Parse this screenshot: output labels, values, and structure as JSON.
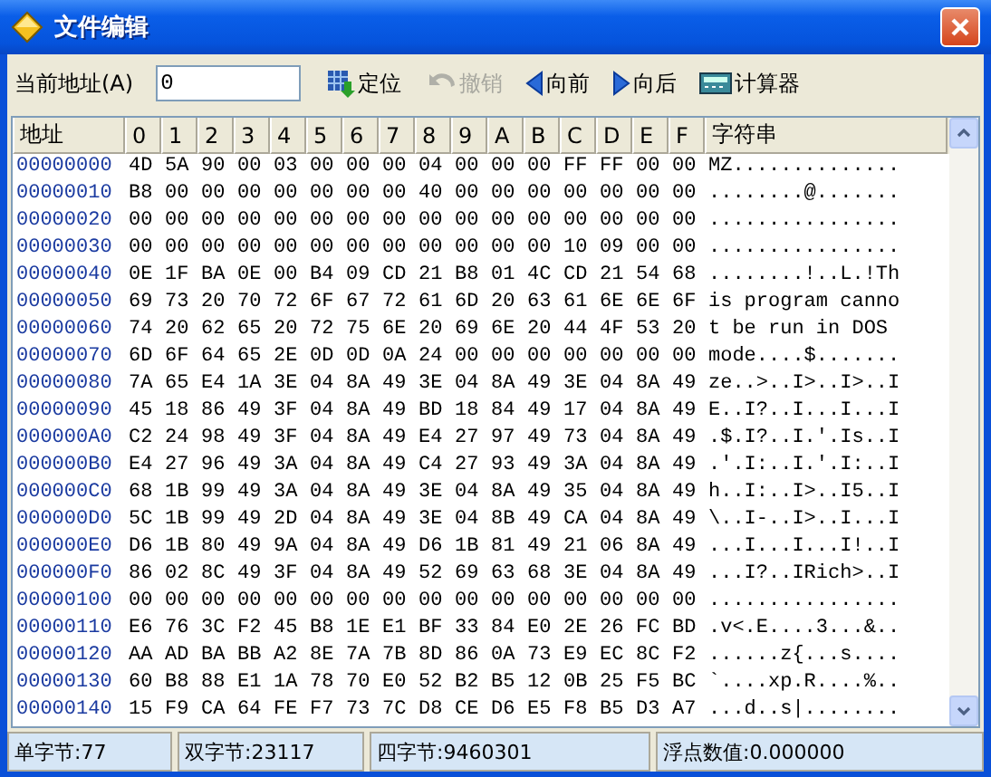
{
  "window": {
    "title": "文件编辑"
  },
  "toolbar": {
    "address_label": "当前地址(A)",
    "address_value": "0",
    "buttons": [
      {
        "kind": "locate",
        "label": "定位",
        "disabled": false
      },
      {
        "kind": "undo",
        "label": "撤销",
        "disabled": true
      },
      {
        "kind": "back",
        "label": "向前",
        "disabled": false
      },
      {
        "kind": "forward",
        "label": "向后",
        "disabled": false
      },
      {
        "kind": "calculator",
        "label": "计算器",
        "disabled": false
      }
    ]
  },
  "table": {
    "columns": [
      "地址",
      "0",
      "1",
      "2",
      "3",
      "4",
      "5",
      "6",
      "7",
      "8",
      "9",
      "A",
      "B",
      "C",
      "D",
      "E",
      "F",
      "字符串"
    ],
    "rows": [
      {
        "address": "00000000",
        "bytes": [
          "4D",
          "5A",
          "90",
          "00",
          "03",
          "00",
          "00",
          "00",
          "04",
          "00",
          "00",
          "00",
          "FF",
          "FF",
          "00",
          "00"
        ],
        "text": "MZ.............."
      },
      {
        "address": "00000010",
        "bytes": [
          "B8",
          "00",
          "00",
          "00",
          "00",
          "00",
          "00",
          "00",
          "40",
          "00",
          "00",
          "00",
          "00",
          "00",
          "00",
          "00"
        ],
        "text": "........@......."
      },
      {
        "address": "00000020",
        "bytes": [
          "00",
          "00",
          "00",
          "00",
          "00",
          "00",
          "00",
          "00",
          "00",
          "00",
          "00",
          "00",
          "00",
          "00",
          "00",
          "00"
        ],
        "text": "................"
      },
      {
        "address": "00000030",
        "bytes": [
          "00",
          "00",
          "00",
          "00",
          "00",
          "00",
          "00",
          "00",
          "00",
          "00",
          "00",
          "00",
          "10",
          "09",
          "00",
          "00"
        ],
        "text": "................"
      },
      {
        "address": "00000040",
        "bytes": [
          "0E",
          "1F",
          "BA",
          "0E",
          "00",
          "B4",
          "09",
          "CD",
          "21",
          "B8",
          "01",
          "4C",
          "CD",
          "21",
          "54",
          "68"
        ],
        "text": "........!..L.!Th"
      },
      {
        "address": "00000050",
        "bytes": [
          "69",
          "73",
          "20",
          "70",
          "72",
          "6F",
          "67",
          "72",
          "61",
          "6D",
          "20",
          "63",
          "61",
          "6E",
          "6E",
          "6F"
        ],
        "text": "is program canno"
      },
      {
        "address": "00000060",
        "bytes": [
          "74",
          "20",
          "62",
          "65",
          "20",
          "72",
          "75",
          "6E",
          "20",
          "69",
          "6E",
          "20",
          "44",
          "4F",
          "53",
          "20"
        ],
        "text": "t be run in DOS "
      },
      {
        "address": "00000070",
        "bytes": [
          "6D",
          "6F",
          "64",
          "65",
          "2E",
          "0D",
          "0D",
          "0A",
          "24",
          "00",
          "00",
          "00",
          "00",
          "00",
          "00",
          "00"
        ],
        "text": "mode....$......."
      },
      {
        "address": "00000080",
        "bytes": [
          "7A",
          "65",
          "E4",
          "1A",
          "3E",
          "04",
          "8A",
          "49",
          "3E",
          "04",
          "8A",
          "49",
          "3E",
          "04",
          "8A",
          "49"
        ],
        "text": "ze..>..I>..I>..I"
      },
      {
        "address": "00000090",
        "bytes": [
          "45",
          "18",
          "86",
          "49",
          "3F",
          "04",
          "8A",
          "49",
          "BD",
          "18",
          "84",
          "49",
          "17",
          "04",
          "8A",
          "49"
        ],
        "text": "E..I?..I...I...I"
      },
      {
        "address": "000000A0",
        "bytes": [
          "C2",
          "24",
          "98",
          "49",
          "3F",
          "04",
          "8A",
          "49",
          "E4",
          "27",
          "97",
          "49",
          "73",
          "04",
          "8A",
          "49"
        ],
        "text": ".$.I?..I.'.Is..I"
      },
      {
        "address": "000000B0",
        "bytes": [
          "E4",
          "27",
          "96",
          "49",
          "3A",
          "04",
          "8A",
          "49",
          "C4",
          "27",
          "93",
          "49",
          "3A",
          "04",
          "8A",
          "49"
        ],
        "text": ".'.I:..I.'.I:..I"
      },
      {
        "address": "000000C0",
        "bytes": [
          "68",
          "1B",
          "99",
          "49",
          "3A",
          "04",
          "8A",
          "49",
          "3E",
          "04",
          "8A",
          "49",
          "35",
          "04",
          "8A",
          "49"
        ],
        "text": "h..I:..I>..I5..I"
      },
      {
        "address": "000000D0",
        "bytes": [
          "5C",
          "1B",
          "99",
          "49",
          "2D",
          "04",
          "8A",
          "49",
          "3E",
          "04",
          "8B",
          "49",
          "CA",
          "04",
          "8A",
          "49"
        ],
        "text": "\\..I-..I>..I...I"
      },
      {
        "address": "000000E0",
        "bytes": [
          "D6",
          "1B",
          "80",
          "49",
          "9A",
          "04",
          "8A",
          "49",
          "D6",
          "1B",
          "81",
          "49",
          "21",
          "06",
          "8A",
          "49"
        ],
        "text": "...I...I...I!..I"
      },
      {
        "address": "000000F0",
        "bytes": [
          "86",
          "02",
          "8C",
          "49",
          "3F",
          "04",
          "8A",
          "49",
          "52",
          "69",
          "63",
          "68",
          "3E",
          "04",
          "8A",
          "49"
        ],
        "text": "...I?..IRich>..I"
      },
      {
        "address": "00000100",
        "bytes": [
          "00",
          "00",
          "00",
          "00",
          "00",
          "00",
          "00",
          "00",
          "00",
          "00",
          "00",
          "00",
          "00",
          "00",
          "00",
          "00"
        ],
        "text": "................"
      },
      {
        "address": "00000110",
        "bytes": [
          "E6",
          "76",
          "3C",
          "F2",
          "45",
          "B8",
          "1E",
          "E1",
          "BF",
          "33",
          "84",
          "E0",
          "2E",
          "26",
          "FC",
          "BD"
        ],
        "text": ".v<.E....3...&.."
      },
      {
        "address": "00000120",
        "bytes": [
          "AA",
          "AD",
          "BA",
          "BB",
          "A2",
          "8E",
          "7A",
          "7B",
          "8D",
          "86",
          "0A",
          "73",
          "E9",
          "EC",
          "8C",
          "F2"
        ],
        "text": "......z{...s...."
      },
      {
        "address": "00000130",
        "bytes": [
          "60",
          "B8",
          "88",
          "E1",
          "1A",
          "78",
          "70",
          "E0",
          "52",
          "B2",
          "B5",
          "12",
          "0B",
          "25",
          "F5",
          "BC"
        ],
        "text": "`....xp.R....%.."
      },
      {
        "address": "00000140",
        "bytes": [
          "15",
          "F9",
          "CA",
          "64",
          "FE",
          "F7",
          "73",
          "7C",
          "D8",
          "CE",
          "D6",
          "E5",
          "F8",
          "B5",
          "D3",
          "A7"
        ],
        "text": "...d..s|........"
      }
    ]
  },
  "status_bar": [
    "单字节:77",
    "双字节:23117",
    "四字节:9460301",
    "浮点数值:0.000000"
  ]
}
